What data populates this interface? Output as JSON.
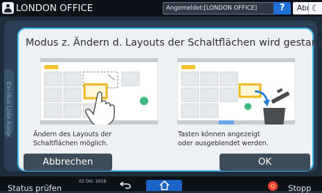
{
  "header": {
    "office_name": "LONDON OFFICE",
    "logged_in_text": "Angemeldet:[LONDON OFFICE]",
    "help_label": "?",
    "logout_label": "Abmelden",
    "moon_label": "☾"
  },
  "background": {
    "side_tab_text": "Ein-/Aus Liste Ausgeben"
  },
  "dialog": {
    "title": "Modus z. Ändern d. Layouts der Schaltflächen wird gestartet.",
    "left_caption": [
      "Ändern des Layouts der",
      "Schaltflächen möglich."
    ],
    "right_caption": [
      "Tasten können angezeigt",
      "oder ausgeblendet werden."
    ],
    "cancel_label": "Abbrechen",
    "ok_label": "OK"
  },
  "footer": {
    "status_label": "Status prüfen",
    "date": "02 Okt. 2018",
    "time": "",
    "stop_label": "Stopp"
  },
  "colors": {
    "dialog_border": "#41b7ee",
    "button": "#3d4c5b",
    "help_button": "#1f6fd9",
    "home_tab": "#1b63c6",
    "stop": "#e8403c"
  }
}
